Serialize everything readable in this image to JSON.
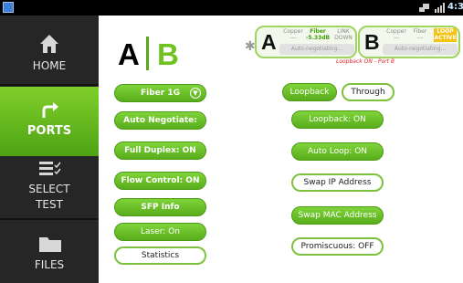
{
  "statusbar": {
    "time": "4:3",
    "app_icon": "app-icon",
    "wifi_icon": "wifi-icon",
    "signal_icon": "signal-icon"
  },
  "sidebar": {
    "items": [
      {
        "label": "HOME",
        "icon": "home-icon"
      },
      {
        "label": "PORTS",
        "icon": "ports-icon",
        "active": true
      },
      {
        "label_line1": "SELECT",
        "label_line2": "TEST",
        "icon": "select-test-icon"
      },
      {
        "label": "FILES",
        "icon": "folder-icon"
      }
    ],
    "active_color": "#5fb51d"
  },
  "header": {
    "port_a": "A",
    "port_b": "B",
    "bluetooth_icon": "bluetooth-icon",
    "card_a": {
      "letter": "A",
      "copper": "Copper",
      "copper_value": "---",
      "fiber": "Fiber",
      "fiber_value": "-5.33dB",
      "link_line1": "LINK",
      "link_line2": "DOWN",
      "negotiation": "Auto-negotiating..."
    },
    "card_b": {
      "letter": "B",
      "copper": "Copper",
      "copper_value": "---",
      "fiber": "Fiber",
      "fiber_value": "---",
      "link_line1": "LOOP",
      "link_line2": "ACTIVE",
      "negotiation": "Auto-negotiating..."
    },
    "port_status": "Loopback ON - Port B"
  },
  "left_controls": {
    "fiber": "Fiber 1G",
    "auto_negotiate": "Auto Negotiate: ON",
    "full_duplex": "Full Duplex: ON",
    "flow_control": "Flow Control: ON",
    "sfp_info": "SFP Info",
    "laser": "Laser: On",
    "statistics": "Statistics"
  },
  "right_controls": {
    "mode_loopback": "Loopback",
    "mode_through": "Through",
    "loopback": "Loopback: ON",
    "auto_loop": "Auto Loop: ON",
    "swap_ip": "Swap IP Address",
    "swap_mac": "Swap MAC Address",
    "promiscuous": "Promiscuous: OFF"
  },
  "colors": {
    "accent_green": "#6fc21f",
    "status_red": "#e0242a",
    "link_amber": "#f4c316",
    "sidebar_bg": "#262626"
  }
}
